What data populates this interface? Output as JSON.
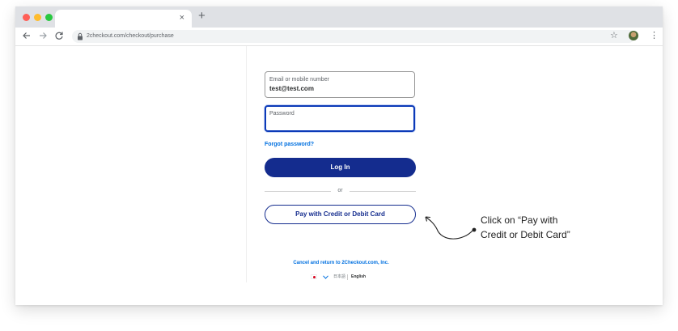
{
  "browser": {
    "new_tab_symbol": "+",
    "tab_close_symbol": "×",
    "url": "2checkout.com/checkout/purchase",
    "star_symbol": "☆",
    "menu_symbol": "⋮"
  },
  "login": {
    "email_label": "Email or mobile number",
    "email_value": "test@test.com",
    "password_label": "Password",
    "forgot_label": "Forgot password?",
    "login_button": "Log In",
    "divider_text": "or",
    "card_button": "Pay with Credit or Debit Card"
  },
  "footer": {
    "cancel_link": "Cancel and return to 2Checkout.com, Inc.",
    "language_option_1": "日本語",
    "language_option_2": "English"
  },
  "annotation": {
    "line1": "Click on “Pay with",
    "line2": "Credit or Debit Card”"
  },
  "colors": {
    "primary": "#142c8e",
    "link": "#0070e0",
    "focus_border": "#0c3ab8"
  }
}
